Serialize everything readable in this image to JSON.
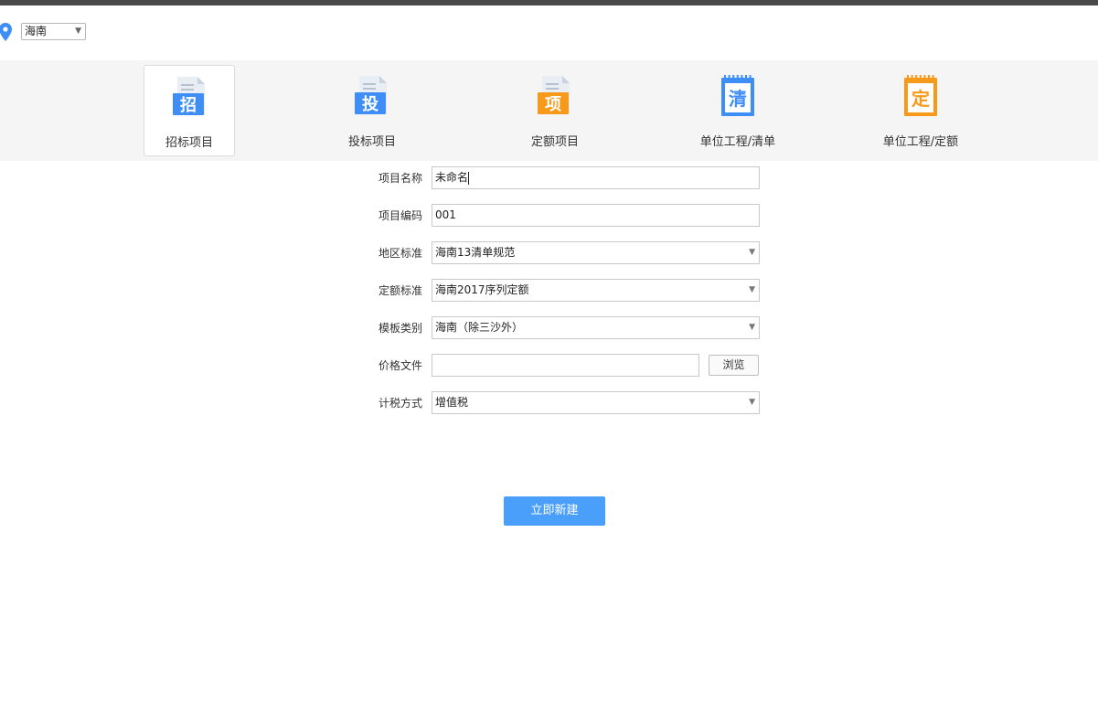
{
  "region": {
    "selected": "海南"
  },
  "project_types": [
    {
      "label": "招标项目",
      "glyph": "招",
      "icon": "tender-project-icon",
      "color": "#3f8ef7",
      "active": true
    },
    {
      "label": "投标项目",
      "glyph": "投",
      "icon": "bid-project-icon",
      "color": "#3f8ef7",
      "active": false
    },
    {
      "label": "定额项目",
      "glyph": "项",
      "icon": "quota-project-icon",
      "color": "#f79a1c",
      "active": false
    },
    {
      "label": "单位工程/清单",
      "glyph": "清",
      "icon": "unit-bill-icon",
      "color": "#3f8ef7",
      "active": false
    },
    {
      "label": "单位工程/定额",
      "glyph": "定",
      "icon": "unit-quota-icon",
      "color": "#f79a1c",
      "active": false
    }
  ],
  "form": {
    "project_name": {
      "label": "项目名称",
      "value": "未命名"
    },
    "project_code": {
      "label": "项目编码",
      "value": "001"
    },
    "region_standard": {
      "label": "地区标准",
      "value": "海南13清单规范"
    },
    "quota_standard": {
      "label": "定额标准",
      "value": "海南2017序列定额"
    },
    "template_type": {
      "label": "模板类别",
      "value": "海南（除三沙外）"
    },
    "price_file": {
      "label": "价格文件",
      "value": "",
      "browse_label": "浏览"
    },
    "tax_method": {
      "label": "计税方式",
      "value": "增值税"
    }
  },
  "actions": {
    "create_label": "立即新建"
  },
  "colors": {
    "accent": "#4a9ffa",
    "orange": "#f79a1c",
    "blue": "#3f8ef7"
  }
}
